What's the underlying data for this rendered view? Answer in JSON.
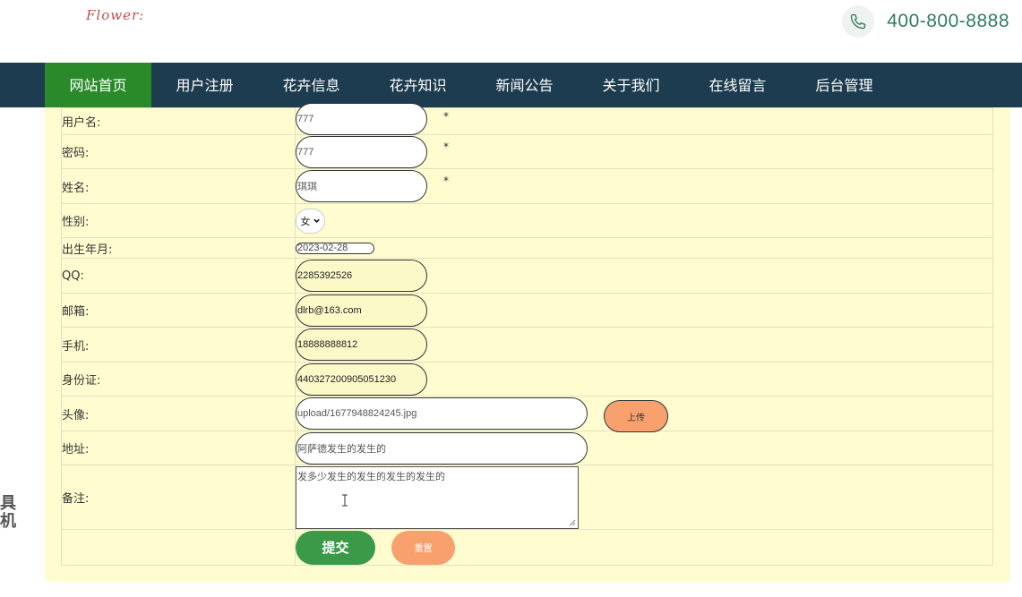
{
  "header": {
    "logo": "Flower:",
    "phone": "400-800-8888"
  },
  "nav": {
    "items": [
      "网站首页",
      "用户注册",
      "花卉信息",
      "花卉知识",
      "新闻公告",
      "关于我们",
      "在线留言",
      "后台管理"
    ]
  },
  "form": {
    "username": {
      "label": "用户名:",
      "value": "777",
      "required": "*"
    },
    "password": {
      "label": "密码:",
      "value": "777",
      "required": "*"
    },
    "name": {
      "label": "姓名:",
      "value": "琪琪",
      "required": "*"
    },
    "gender": {
      "label": "性别:",
      "value": "女"
    },
    "birthdate": {
      "label": "出生年月:",
      "value": "2023-02-28"
    },
    "qq": {
      "label": "QQ:",
      "value": "2285392526"
    },
    "email": {
      "label": "邮箱:",
      "value": "dlrb@163.com"
    },
    "mobile": {
      "label": "手机:",
      "value": "18888888812"
    },
    "idcard": {
      "label": "身份证:",
      "value": "440327200905051230"
    },
    "avatar": {
      "label": "头像:",
      "value": "upload/1677948824245.jpg",
      "upload_label": "上传"
    },
    "address": {
      "label": "地址:",
      "value": "阿萨德发生的发生的"
    },
    "notes": {
      "label": "备注:",
      "value": "发多少发生的发生的发生的发生的"
    },
    "submit_label": "提交",
    "reset_label": "重置"
  },
  "side_deco": [
    "具",
    "机"
  ],
  "colors": {
    "nav_bg": "#1d3c4f",
    "nav_active": "#2a8a2a",
    "content_bg": "#fffdd0",
    "submit": "#3a9a48",
    "reset": "#f9a06f",
    "phone": "#2e7d5b"
  }
}
